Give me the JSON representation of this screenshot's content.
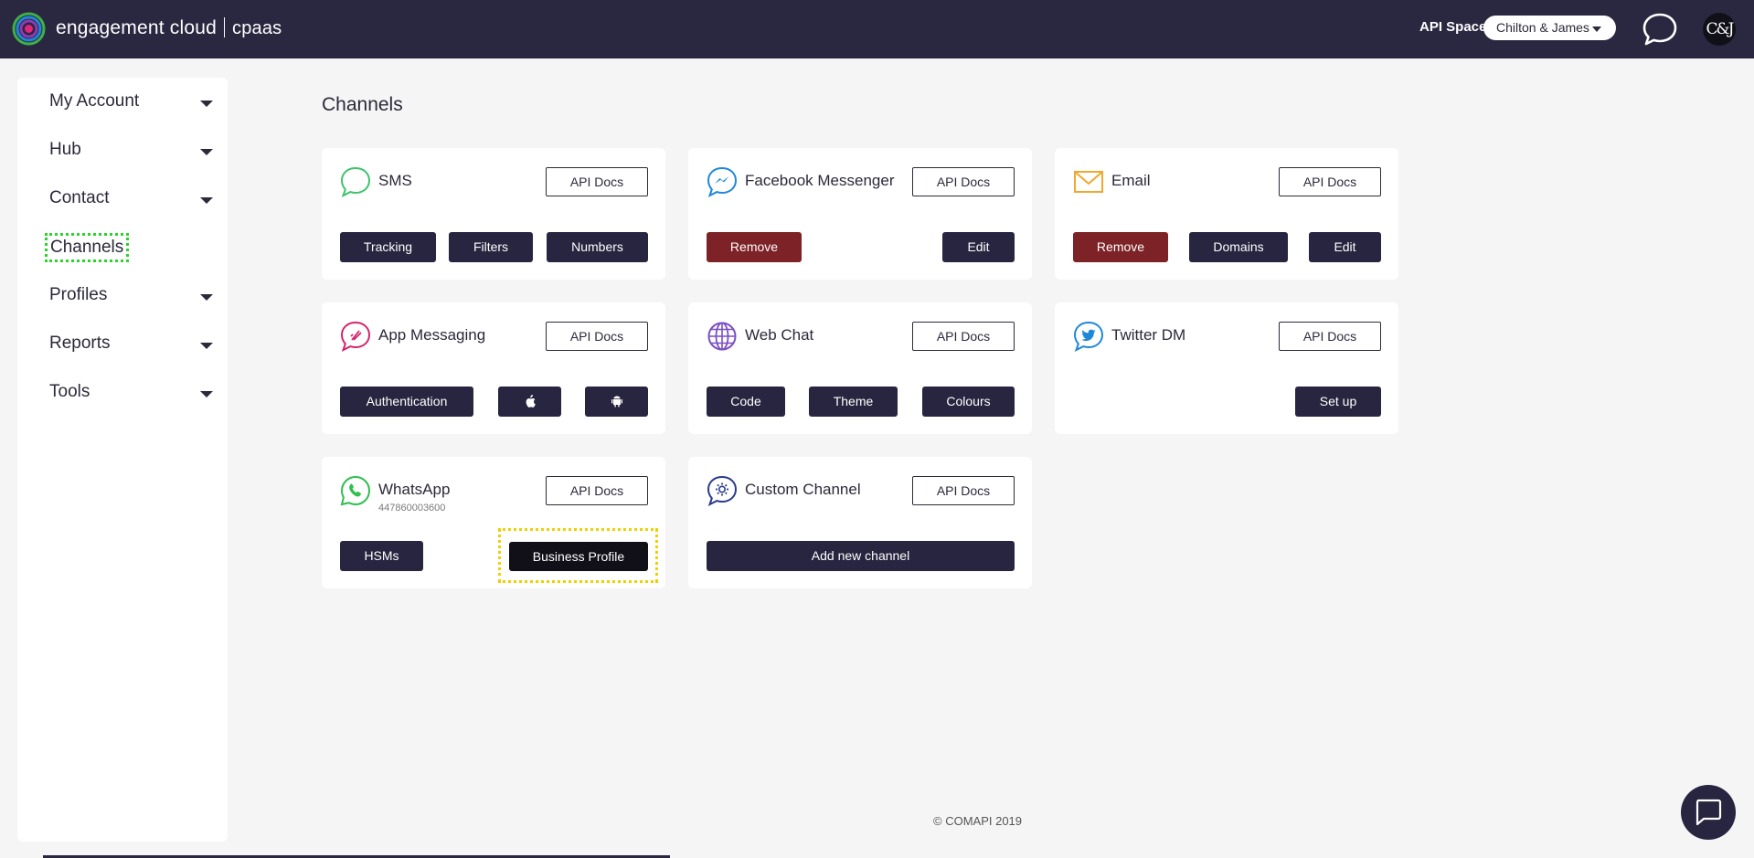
{
  "header": {
    "brand_name": "engagement cloud",
    "brand_suffix": "cpaas",
    "api_space_label": "API Space:",
    "api_space_value": "Chilton & James",
    "avatar_text": "C&J",
    "colors": {
      "bar": "#2a2840",
      "accent_ring": [
        "#3fb04a",
        "#1e88d8",
        "#8e3ab8",
        "#e0267a"
      ]
    }
  },
  "sidebar": {
    "items": [
      {
        "label": "My Account",
        "has_caret": true
      },
      {
        "label": "Hub",
        "has_caret": true
      },
      {
        "label": "Contact",
        "has_caret": true
      },
      {
        "label": "Channels",
        "has_caret": false,
        "focused": true
      },
      {
        "label": "Profiles",
        "has_caret": true
      },
      {
        "label": "Reports",
        "has_caret": true
      },
      {
        "label": "Tools",
        "has_caret": true
      }
    ]
  },
  "main": {
    "title": "Channels",
    "api_docs_label": "API Docs",
    "cards": {
      "sms": {
        "title": "SMS",
        "icon": "sms-bubble-icon",
        "buttons": [
          "Tracking",
          "Filters",
          "Numbers"
        ]
      },
      "facebook": {
        "title": "Facebook Messenger",
        "icon": "messenger-icon",
        "buttons": [
          "Remove",
          "Edit"
        ]
      },
      "email": {
        "title": "Email",
        "icon": "envelope-icon",
        "buttons": [
          "Remove",
          "Domains",
          "Edit"
        ]
      },
      "app_messaging": {
        "title": "App Messaging",
        "icon": "app-messaging-icon",
        "buttons": [
          "Authentication",
          "apple-icon",
          "android-icon"
        ]
      },
      "web_chat": {
        "title": "Web Chat",
        "icon": "globe-icon",
        "buttons": [
          "Code",
          "Theme",
          "Colours"
        ]
      },
      "twitter": {
        "title": "Twitter DM",
        "icon": "twitter-bird-icon",
        "buttons": [
          "Set up"
        ]
      },
      "whatsapp": {
        "title": "WhatsApp",
        "subtitle": "447860003600",
        "icon": "whatsapp-icon",
        "buttons": [
          "HSMs",
          "Business Profile"
        ]
      },
      "custom": {
        "title": "Custom Channel",
        "icon": "gear-bubble-icon",
        "buttons": [
          "Add new channel"
        ]
      }
    }
  },
  "footer": {
    "text": "© COMAPI 2019"
  }
}
